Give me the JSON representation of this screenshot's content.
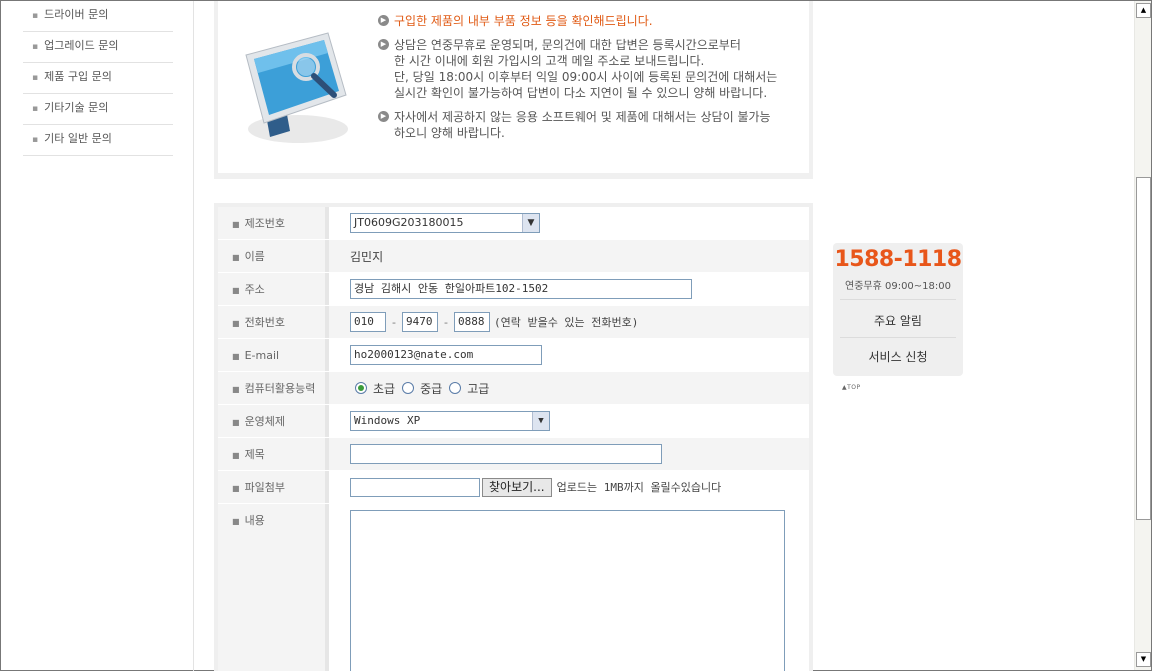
{
  "sidebar": {
    "items": [
      {
        "label": "드라이버 문의"
      },
      {
        "label": "업그레이드 문의"
      },
      {
        "label": "제품 구입 문의"
      },
      {
        "label": "기타기술 문의"
      },
      {
        "label": "기타 일반 문의"
      }
    ]
  },
  "notice": {
    "items": [
      {
        "lines": [
          "구입한 제품의 내부 부품 정보 등을 확인해드립니다."
        ]
      },
      {
        "lines": [
          "상담은 연중무휴로 운영되며, 문의건에 대한 답변은 등록시간으로부터",
          "한 시간 이내에 회원 가입시의 고객 메일 주소로 보내드립니다.",
          "단, 당일 18:00시 이후부터 익일 09:00시 사이에 등록된 문의건에 대해서는",
          "실시간 확인이 불가능하여 답변이 다소 지연이 될 수 있으니 양해 바랍니다."
        ]
      },
      {
        "lines": [
          "자사에서 제공하지 않는 응용 소프트웨어 및 제품에 대해서는 상담이 불가능",
          "하오니 양해 바랍니다."
        ]
      }
    ],
    "highlight_color": "#e05a14"
  },
  "form": {
    "serial": {
      "label": "제조번호",
      "value": "JT0609G203180015"
    },
    "name": {
      "label": "이름",
      "value": "김민지"
    },
    "address": {
      "label": "주소",
      "value": "경남 김해시 안동 한일아파트102-1502"
    },
    "phone": {
      "label": "전화번호",
      "p1": "010",
      "p2": "9470",
      "p3": "0888",
      "note": "(연락 받을수 있는 전화번호)"
    },
    "email": {
      "label": "E-mail",
      "value": "ho2000123@nate.com"
    },
    "skill": {
      "label": "컴퓨터활용능력",
      "options": [
        "초급",
        "중급",
        "고급"
      ],
      "selected": "초급"
    },
    "os": {
      "label": "운영체제",
      "value": "Windows XP"
    },
    "subject": {
      "label": "제목",
      "value": ""
    },
    "file": {
      "label": "파일첨부",
      "value": "",
      "button": "찾아보기...",
      "note": "업로드는 1MB까지 올릴수있습니다"
    },
    "content": {
      "label": "내용",
      "value": ""
    }
  },
  "customer_service": {
    "phone": "1588-1118",
    "hours": "연중무휴 09:00~18:00",
    "links": [
      "주요 알림",
      "서비스 신청"
    ],
    "phone_color": "#e8561a"
  },
  "top_link": "▲TOP"
}
